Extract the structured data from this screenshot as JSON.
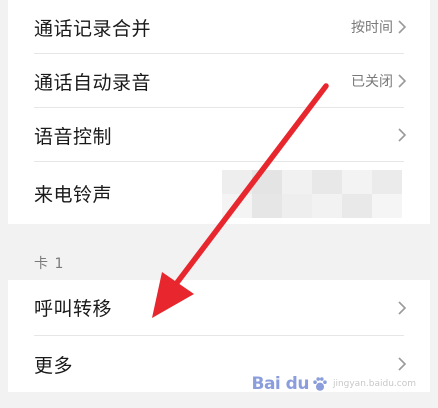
{
  "settings": {
    "rows": [
      {
        "label": "通话记录合并",
        "value": "按时间"
      },
      {
        "label": "通话自动录音",
        "value": "已关闭"
      },
      {
        "label": "语音控制",
        "value": ""
      },
      {
        "label": "来电铃声",
        "value": ""
      }
    ]
  },
  "card": {
    "label": "卡 1",
    "rows": [
      {
        "label": "呼叫转移"
      },
      {
        "label": "更多"
      }
    ]
  },
  "watermark": {
    "logo_text": "Bai du",
    "sub_text": "jingyan.baidu.com"
  },
  "colors": {
    "arrow": "#e8262e",
    "secondary_text": "#7a7a7a",
    "divider": "#e6e6e6"
  },
  "icons": {
    "chevron": "chevron-right-icon",
    "arrow": "red-annotation-arrow"
  }
}
